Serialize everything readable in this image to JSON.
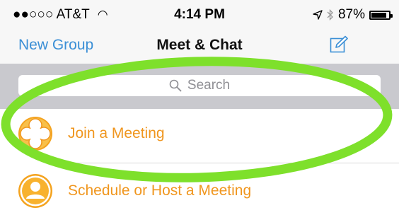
{
  "status_bar": {
    "carrier": "●●○○○ AT&T",
    "wifi_icon": "wifi-icon",
    "time": "4:14 PM",
    "location_icon": "location-arrow-icon",
    "bluetooth_icon": "bluetooth-icon",
    "battery_percent": "87%",
    "battery_level": 0.87
  },
  "nav": {
    "left_button": "New Group",
    "title": "Meet & Chat",
    "compose_icon": "compose-icon"
  },
  "search": {
    "placeholder": "Search",
    "icon": "search-icon"
  },
  "list": {
    "items": [
      {
        "label": "Join a Meeting",
        "icon": "join-meeting-icon"
      },
      {
        "label": "Schedule or Host a Meeting",
        "icon": "host-meeting-icon"
      }
    ]
  },
  "colors": {
    "accent_blue": "#3b8fd6",
    "accent_orange": "#f0961e",
    "highlight_green": "#7ee02b"
  }
}
